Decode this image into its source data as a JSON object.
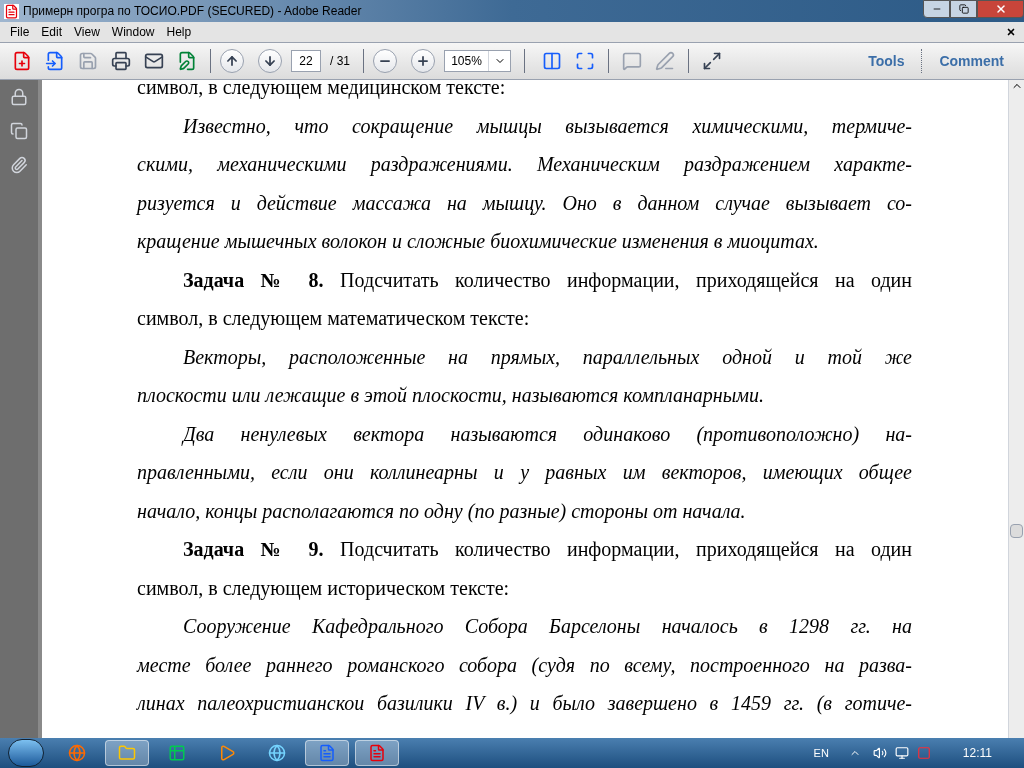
{
  "window": {
    "title": "Примерн програ по ТОСИО.PDF (SECURED) - Adobe Reader"
  },
  "menu": [
    "File",
    "Edit",
    "View",
    "Window",
    "Help"
  ],
  "toolbar": {
    "page": "22",
    "page_count": "/ 31",
    "zoom": "105%",
    "tools": "Tools",
    "comment": "Comment"
  },
  "paragraphs": [
    {
      "kind": "plain",
      "lines": [
        "символ, в следующем медицинском тексте:"
      ]
    },
    {
      "kind": "quote",
      "lines": [
        "Известно, что сокращение мышцы вызывается химическими, термиче-",
        "скими, механическими раздражениями. Механическим раздражением характе-",
        "ризуется и действие массажа на мышцу. Оно в данном случае вызывает со-",
        "кращение мышечных волокон и сложные биохимические изменения в миоцитах."
      ]
    },
    {
      "kind": "task",
      "lines": [
        "**Задача № 8.** Подсчитать количество информации, приходящейся на один",
        "символ, в следующем математическом тексте:"
      ]
    },
    {
      "kind": "quote",
      "lines": [
        " Векторы, расположенные на прямых, параллельных одной и той же",
        "плоскости или лежащие в этой плоскости, называются компланарными."
      ]
    },
    {
      "kind": "quote",
      "lines": [
        " Два ненулевых вектора называются одинаково (противоположно) на-",
        "правленными, если они коллинеарны и у равных им векторов, имеющих общее",
        "начало, концы располагаются по одну (по разные) стороны от начала."
      ]
    },
    {
      "kind": "task",
      "lines": [
        "**Задача № 9.** Подсчитать количество информации, приходящейся на один",
        "символ, в следующем историческом тексте:"
      ]
    },
    {
      "kind": "quote",
      "lines": [
        "Сооружение Кафедрального Собора Барселоны началось в 1298 гг. на",
        "месте более раннего романского собора (судя по всему, построенного на разва-",
        "линах палеохристианскои базилики IV в.) и было завершено в 1459 гг. (в готиче-"
      ]
    }
  ],
  "taskbar": {
    "apps": [
      {
        "kind": "firefox",
        "running": false
      },
      {
        "kind": "explorer",
        "running": true
      },
      {
        "kind": "excel",
        "running": false
      },
      {
        "kind": "media",
        "running": false
      },
      {
        "kind": "ie",
        "running": false
      },
      {
        "kind": "word",
        "running": true
      },
      {
        "kind": "pdf",
        "running": true
      }
    ],
    "language": "EN",
    "time": "12:11"
  }
}
